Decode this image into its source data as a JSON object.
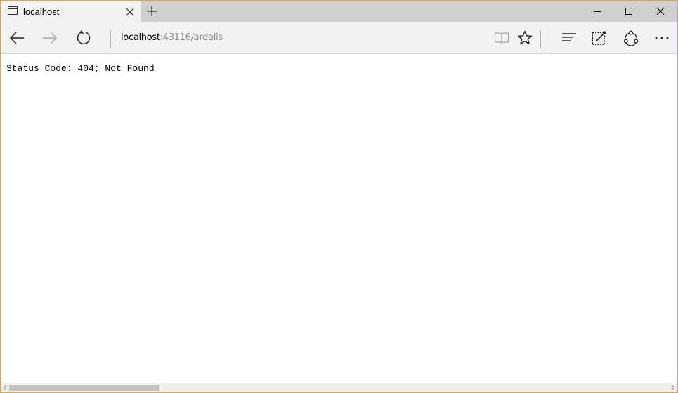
{
  "tab": {
    "title": "localhost"
  },
  "address": {
    "host": "localhost",
    "rest": ":43116/ardalis"
  },
  "page": {
    "message": "Status Code: 404; Not Found"
  },
  "colors": {
    "window_border": "#e0a63a",
    "titlebar": "#cfcfcf",
    "toolbar": "#f2f2f2"
  },
  "icons": {
    "tab": "tab-page-icon",
    "close_tab": "close-icon",
    "new_tab": "plus-icon",
    "minimize": "minimize-icon",
    "maximize": "maximize-icon",
    "close_window": "close-icon",
    "back": "arrow-left-icon",
    "forward": "arrow-right-icon",
    "refresh": "refresh-icon",
    "reading_view": "book-icon",
    "favorite": "star-icon",
    "hub": "hub-icon",
    "web_note": "pen-note-icon",
    "share": "share-icon",
    "more": "ellipsis-icon"
  },
  "scrollbar": {
    "horizontal_position": 0.0
  }
}
